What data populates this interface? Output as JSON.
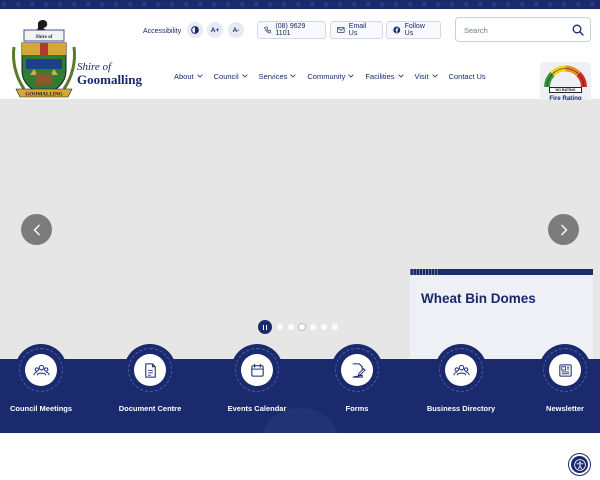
{
  "brand": {
    "logo_line1": "Shire of",
    "logo_line2": "Goomalling",
    "crest_banner": "GOOMALLING",
    "crest_top": "Shire of"
  },
  "utility": {
    "accessibility_label": "Accessibility",
    "contrast_icon": "contrast-icon",
    "font_increase": "A+",
    "font_decrease": "A-",
    "phone": "(08) 9629 1101",
    "email": "Email Us",
    "follow": "Follow Us"
  },
  "search": {
    "placeholder": "Search"
  },
  "nav": {
    "items": [
      {
        "label": "About",
        "has_dropdown": true
      },
      {
        "label": "Council",
        "has_dropdown": true
      },
      {
        "label": "Services",
        "has_dropdown": true
      },
      {
        "label": "Community",
        "has_dropdown": true
      },
      {
        "label": "Facilities",
        "has_dropdown": true
      },
      {
        "label": "Visit",
        "has_dropdown": true
      },
      {
        "label": "Contact Us",
        "has_dropdown": false
      }
    ]
  },
  "fire_rating": {
    "status": "NO RATING",
    "label": "Fire Rating"
  },
  "hero": {
    "caption": "Wheat Bin Domes",
    "slide_count": 6,
    "active_slide": 3
  },
  "quick_links": [
    {
      "label": "Council Meetings",
      "icon": "people-group-icon"
    },
    {
      "label": "Document Centre",
      "icon": "document-icon"
    },
    {
      "label": "Events Calendar",
      "icon": "calendar-icon"
    },
    {
      "label": "Forms",
      "icon": "form-edit-icon"
    },
    {
      "label": "Business Directory",
      "icon": "people-group-icon"
    },
    {
      "label": "Newsletter",
      "icon": "newsletter-icon"
    }
  ],
  "colors": {
    "navy": "#1a2a6c",
    "hero_placeholder": "#e6e6e6",
    "arrow": "#7c7c7c"
  }
}
